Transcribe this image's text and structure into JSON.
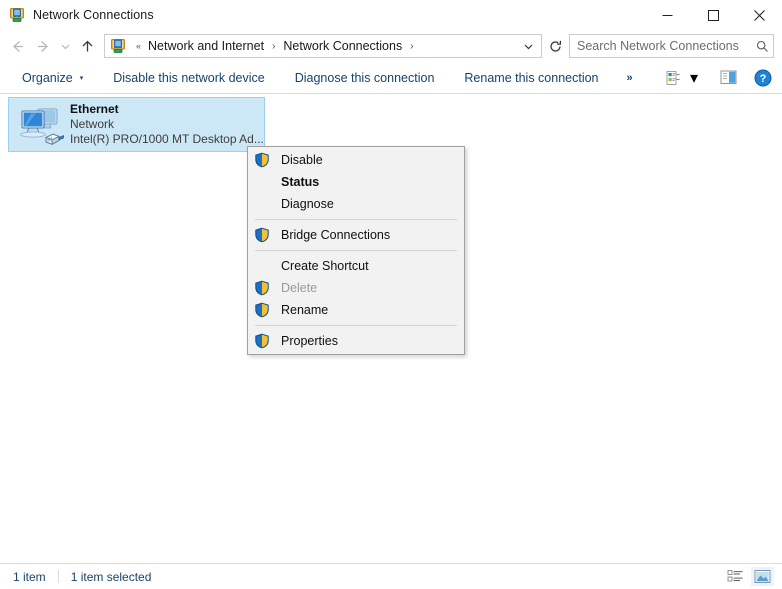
{
  "window": {
    "title": "Network Connections",
    "title_icon": "network-connections-icon",
    "minimize_label": "─",
    "maximize_label": "□",
    "close_label": "✕"
  },
  "address_bar": {
    "back_label": "←",
    "forward_label": "→",
    "recent_label": "⌄",
    "up_label": "↑",
    "icon": "network-connections-icon",
    "overflow_chevron": "«",
    "crumbs": [
      {
        "label": "Network and Internet"
      },
      {
        "label": "Network Connections"
      }
    ],
    "separator": "›",
    "dropdown_label": "⌄",
    "refresh_label": "↻"
  },
  "search": {
    "placeholder": "Search Network Connections",
    "value": "",
    "icon": "search-icon"
  },
  "command_bar": {
    "items": [
      {
        "label": "Organize",
        "has_caret": true
      },
      {
        "label": "Disable this network device",
        "has_caret": false
      },
      {
        "label": "Diagnose this connection",
        "has_caret": false
      },
      {
        "label": "Rename this connection",
        "has_caret": false
      }
    ],
    "caret": "▾",
    "overflow_label": "»",
    "view_button": "view-options-icon",
    "view_caret": "▾",
    "preview_pane_button": "preview-pane-icon",
    "help_button": "help-icon",
    "help_glyph": "?"
  },
  "connection": {
    "name": "Ethernet",
    "network": "Network",
    "adapter": "Intel(R) PRO/1000 MT Desktop Ad...",
    "icon": "ethernet-adapter-icon",
    "selected": true
  },
  "context_menu": {
    "groups": [
      {
        "items": [
          {
            "label": "Disable",
            "shield": true,
            "bold": false,
            "disabled": false
          },
          {
            "label": "Status",
            "shield": false,
            "bold": true,
            "disabled": false
          },
          {
            "label": "Diagnose",
            "shield": false,
            "bold": false,
            "disabled": false
          }
        ]
      },
      {
        "items": [
          {
            "label": "Bridge Connections",
            "shield": true,
            "bold": false,
            "disabled": false
          }
        ]
      },
      {
        "items": [
          {
            "label": "Create Shortcut",
            "shield": false,
            "bold": false,
            "disabled": false
          },
          {
            "label": "Delete",
            "shield": true,
            "bold": false,
            "disabled": true
          },
          {
            "label": "Rename",
            "shield": true,
            "bold": false,
            "disabled": false
          }
        ]
      },
      {
        "items": [
          {
            "label": "Properties",
            "shield": true,
            "bold": false,
            "disabled": false
          }
        ]
      }
    ]
  },
  "status_bar": {
    "item_count": "1 item",
    "selection": "1 item selected",
    "details_view_button": "details-view-icon",
    "icons_view_button": "large-icons-view-icon"
  },
  "colors": {
    "accent_link": "#17436b",
    "selection_fill": "#cce8f7",
    "selection_border": "#99d1ef",
    "shield_blue": "#1d6fc4",
    "shield_gold": "#f5c131",
    "menu_bg": "#f2f2f2",
    "close_hover": "#e81123"
  }
}
